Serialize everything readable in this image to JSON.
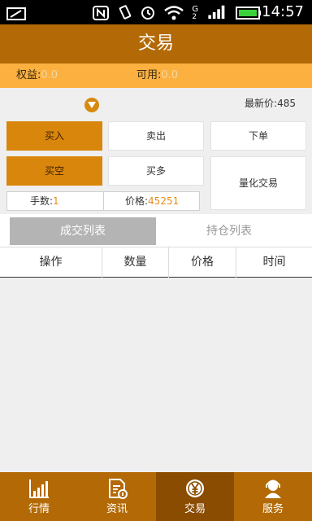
{
  "status_bar": {
    "time": "14:57"
  },
  "title": "交易",
  "account": {
    "equity_label": "权益:",
    "equity_value": "0.0",
    "available_label": "可用:",
    "available_value": "0.0"
  },
  "latest_price_label": "最新价:485",
  "buttons": {
    "buy": "买入",
    "sell": "卖出",
    "place_order": "下单",
    "short": "买空",
    "long": "买多",
    "quant_trade": "量化交易"
  },
  "fields": {
    "lots_label": "手数:",
    "lots_value": "1",
    "price_label": "价格:",
    "price_value": "45251"
  },
  "tabs": {
    "deals": "成交列表",
    "positions": "持仓列表"
  },
  "table_headers": [
    "操作",
    "数量",
    "价格",
    "时间"
  ],
  "nav": [
    {
      "label": "行情",
      "icon": "bar-chart-icon"
    },
    {
      "label": "资讯",
      "icon": "document-icon"
    },
    {
      "label": "交易",
      "icon": "yen-coin-icon"
    },
    {
      "label": "服务",
      "icon": "headset-user-icon"
    }
  ],
  "colors": {
    "brand": "#b36a06",
    "accent": "#d9860c",
    "account_bar": "#fbb040"
  }
}
